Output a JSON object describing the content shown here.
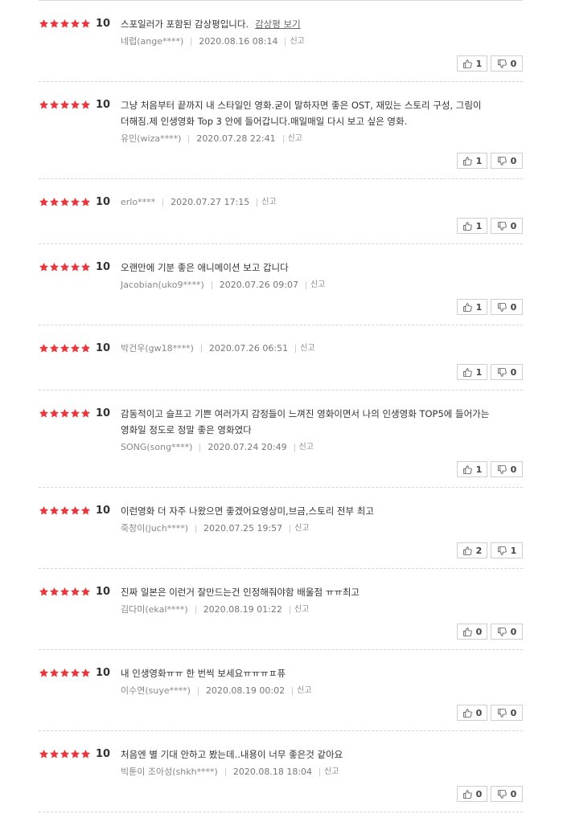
{
  "colors": {
    "star": "#e8383d",
    "text": "#333333",
    "meta": "#888888",
    "border": "#cfcfcf"
  },
  "labels": {
    "spoiler_link": "감상평 보기",
    "report": "신고"
  },
  "reviews": [
    {
      "score": "10",
      "text": "스포일러가 포함된 감상평입니다.",
      "spoiler": true,
      "author": "네럽(ange****)",
      "date": "2020.08.16 08:14",
      "likes": "1",
      "dislikes": "0"
    },
    {
      "score": "10",
      "text": "그냥 처음부터 끝까지 내 스타일인 영화.굳이 말하자면 좋은 OST, 재밌는 스토리 구성, 그림이 더해짐.제 인생영화 Top 3 안에 들어갑니다.매일매일 다시 보고 싶은 영화.",
      "spoiler": false,
      "author": "유민(wiza****)",
      "date": "2020.07.28 22:41",
      "likes": "1",
      "dislikes": "0"
    },
    {
      "score": "10",
      "text": "",
      "spoiler": false,
      "author": "erlo****",
      "date": "2020.07.27 17:15",
      "likes": "1",
      "dislikes": "0"
    },
    {
      "score": "10",
      "text": "오랜만에 기분 좋은 애니메이션 보고 갑니다",
      "spoiler": false,
      "author": "Jacobian(uko9****)",
      "date": "2020.07.26 09:07",
      "likes": "1",
      "dislikes": "0"
    },
    {
      "score": "10",
      "text": "",
      "spoiler": false,
      "author": "박건우(gw18****)",
      "date": "2020.07.26 06:51",
      "likes": "1",
      "dislikes": "0"
    },
    {
      "score": "10",
      "text": "감동적이고 슬프고 기쁜 여러가지 감정들이 느껴진 영화이면서 나의 인생영화 TOP5에 들어가는 영화일 정도로 정말 좋은 영화였다",
      "spoiler": false,
      "author": "SONG(song****)",
      "date": "2020.07.24 20:49",
      "likes": "1",
      "dislikes": "0"
    },
    {
      "score": "10",
      "text": "이런영화 더 자주 나왔으면 좋겠어요영상미,브금,스토리 전부 최고",
      "spoiler": false,
      "author": "죽창이(juch****)",
      "date": "2020.07.25 19:57",
      "likes": "2",
      "dislikes": "1"
    },
    {
      "score": "10",
      "text": "진짜 일본은 이런거 잘만드는건 인정해줘야함 배울점 ㅠㅠ최고",
      "spoiler": false,
      "author": "김다미(ekal****)",
      "date": "2020.08.19 01:22",
      "likes": "0",
      "dislikes": "0"
    },
    {
      "score": "10",
      "text": "내 인생영화ㅠㅠ 한 번씩 보세요ㅠㅠㅠㅍ퓨",
      "spoiler": false,
      "author": "이수연(suye****)",
      "date": "2020.08.19 00:02",
      "likes": "0",
      "dislikes": "0"
    },
    {
      "score": "10",
      "text": "처음엔 별 기대 안하고 봤는데..내용이 너무 좋은것 같아요",
      "spoiler": false,
      "author": "빅툰이 조아성(shkh****)",
      "date": "2020.08.18 18:04",
      "likes": "0",
      "dislikes": "0"
    }
  ]
}
